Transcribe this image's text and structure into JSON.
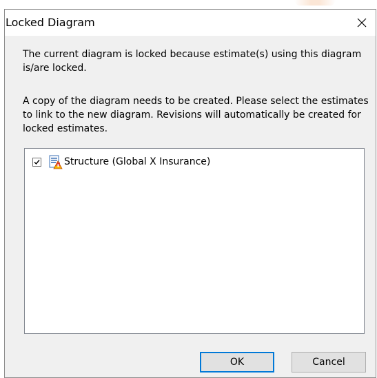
{
  "dialog": {
    "title": "Locked Diagram",
    "close_icon": "close-icon",
    "message_1": "The current diagram is locked because estimate(s) using this diagram is/are locked.",
    "message_2": "A copy of the diagram needs to be created.  Please select the estimates to link to the new diagram.  Revisions will automatically be created for locked estimates.",
    "estimates": [
      {
        "label": "Structure (Global X Insurance)",
        "checked": true,
        "icon": "estimate-document-icon"
      }
    ],
    "buttons": {
      "ok_label": "OK",
      "cancel_label": "Cancel"
    },
    "colors": {
      "default_button_border": "#0078d7",
      "dialog_background": "#f0f0f0"
    }
  }
}
